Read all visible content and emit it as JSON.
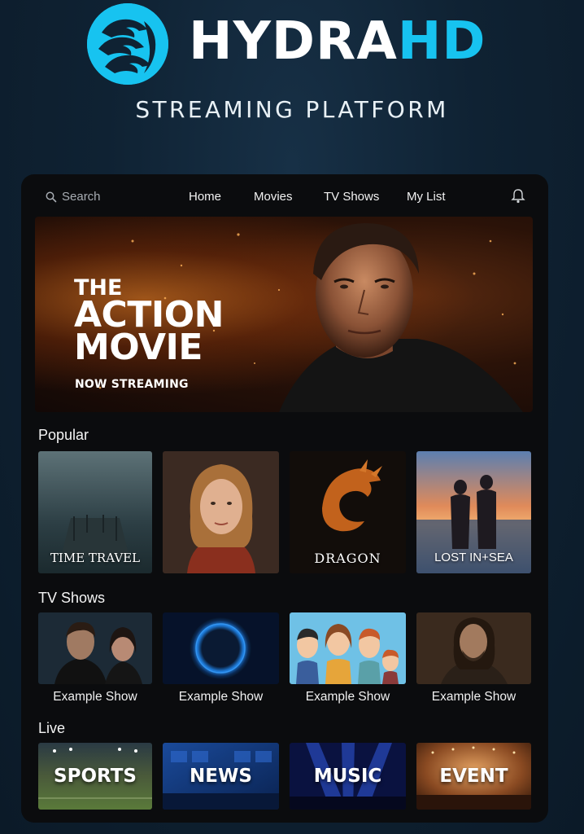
{
  "brand": {
    "name_part1": "HYDRA",
    "name_part2": "HD",
    "tagline": "STREAMING PLATFORM",
    "accent_color": "#17c3f0",
    "logo_icon": "hydra-logo"
  },
  "nav": {
    "search_placeholder": "Search",
    "search_icon": "search-icon",
    "links": [
      "Home",
      "Movies",
      "TV Shows",
      "My List"
    ],
    "bell_icon": "bell-icon"
  },
  "hero": {
    "title_line1": "THE",
    "title_line2": "ACTION",
    "title_line3": "MOVIE",
    "subtitle": "NOW STREAMING"
  },
  "popular": {
    "title": "Popular",
    "items": [
      "TIME TRAVEL",
      "",
      "DRAGON",
      "LOST IN+SEA"
    ]
  },
  "tv_shows": {
    "title": "TV Shows",
    "items": [
      "Example Show",
      "Example Show",
      "Example Show",
      "Example Show"
    ]
  },
  "live": {
    "title": "Live",
    "items": [
      "SPORTS",
      "NEWS",
      "MUSIC",
      "EVENT"
    ]
  }
}
